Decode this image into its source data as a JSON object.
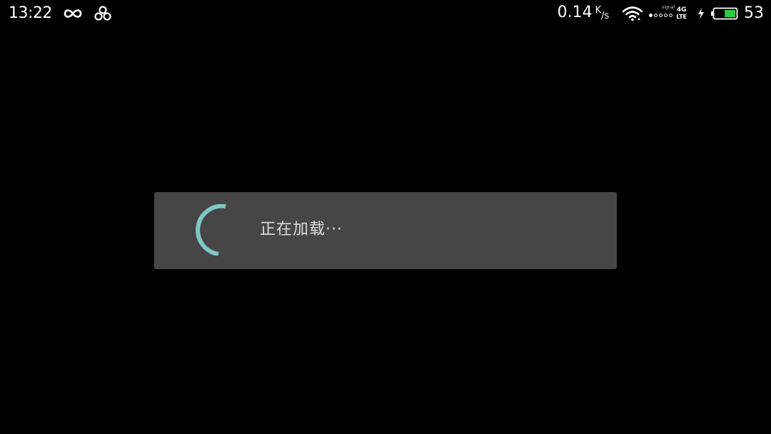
{
  "status_bar": {
    "time": "13:22",
    "left_icons": [
      "infinity-icon",
      "clover-icon"
    ],
    "net_speed": "0.14",
    "net_speed_unit_top": "K",
    "net_speed_unit_bottom": "s",
    "signal_label": "signal",
    "net_type_top": "4G",
    "net_type_bottom": "LTE",
    "battery_level": "53",
    "battery_fraction": 0.53,
    "battery_color": "#2ecc40",
    "charging": true
  },
  "dialog": {
    "message": "正在加载···",
    "spinner_color": "#7fc8c4",
    "background": "#464646"
  }
}
